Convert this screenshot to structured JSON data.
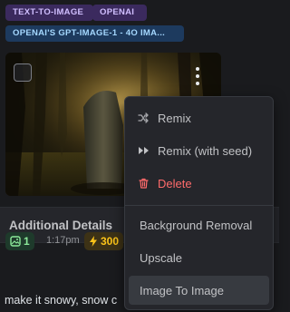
{
  "badges": [
    {
      "label": "TEXT-TO-IMAGE"
    },
    {
      "label": "OPENAI"
    },
    {
      "label": "OPENAI'S GPT-IMAGE-1 - 4O IMA..."
    }
  ],
  "image_card": {
    "alt_icon": "forest-standing-stone-image",
    "select_checkbox": "checkbox",
    "menu_icon": "kebab-menu-icon"
  },
  "details": {
    "title": "Additional Details"
  },
  "stats": {
    "image_count": "1",
    "time": "1:17pm",
    "buzz": "300"
  },
  "prompt_text": "make it snowy, snow c",
  "context_menu": {
    "items": [
      {
        "label": "Remix",
        "icon": "shuffle-icon"
      },
      {
        "label": "Remix (with seed)",
        "icon": "fast-forward-icon"
      },
      {
        "label": "Delete",
        "icon": "trash-icon"
      },
      {
        "label": "Background Removal"
      },
      {
        "label": "Upscale"
      },
      {
        "label": "Image To Image"
      }
    ]
  },
  "colors": {
    "background": "#1a1b1e",
    "menu_bg": "#25262b",
    "danger": "#ff6b6b",
    "buzz": "#fcc419",
    "count": "#8ce99a"
  }
}
